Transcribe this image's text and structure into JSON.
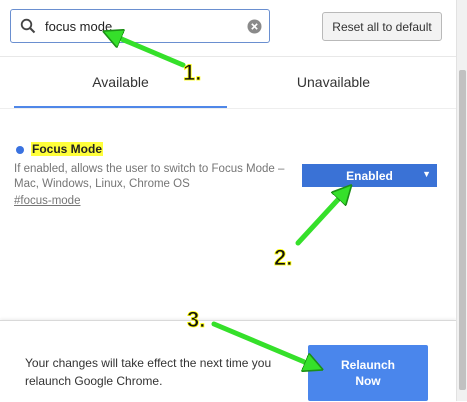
{
  "search": {
    "value": "focus mode"
  },
  "toolbar": {
    "reset_label": "Reset all to default"
  },
  "tabs": [
    {
      "label": "Available"
    },
    {
      "label": "Unavailable"
    }
  ],
  "flag": {
    "name": "Focus Mode",
    "description": "If enabled, allows the user to switch to Focus Mode – Mac, Windows, Linux, Chrome OS",
    "link": "#focus-mode",
    "selected_option": "Enabled"
  },
  "footer": {
    "message": "Your changes will take effect the next time you relaunch Google Chrome.",
    "relaunch_label_line1": "Relaunch",
    "relaunch_label_line2": "Now"
  },
  "annotations": [
    {
      "label": "1."
    },
    {
      "label": "2."
    },
    {
      "label": "3."
    }
  ],
  "colors": {
    "accent": "#3a72d6",
    "arrow": "#35e02a",
    "highlight": "#ffff3a"
  },
  "icons": [
    "search-icon",
    "clear-icon",
    "dropdown-caret-icon"
  ]
}
